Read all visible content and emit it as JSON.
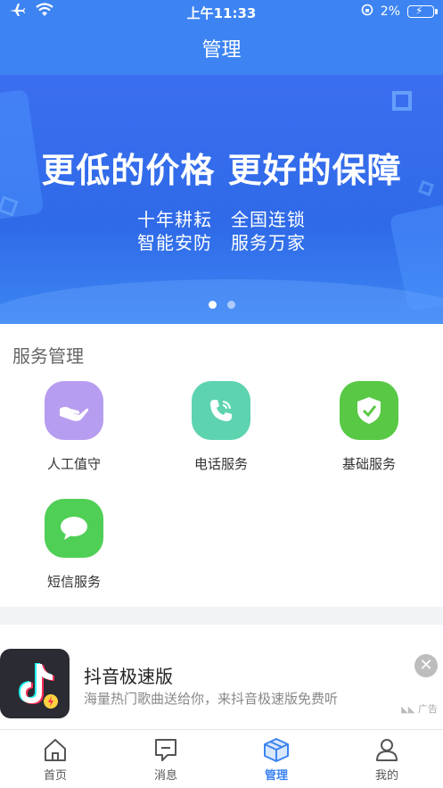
{
  "status_bar": {
    "time": "上午11:33",
    "battery": "2%",
    "icons": [
      "airplane-icon",
      "wifi-icon",
      "rotation-lock-icon",
      "battery-charging-icon"
    ]
  },
  "header": {
    "title": "管理"
  },
  "banner": {
    "headline": "更低的价格 更好的保障",
    "line1": "十年耕耘　全国连锁",
    "line2": "智能安防　服务万家",
    "page_indicator": {
      "count": 2,
      "active": 1
    }
  },
  "services": {
    "title": "服务管理",
    "items": [
      {
        "label": "人工值守",
        "icon": "hand-icon",
        "color": "#b79df0"
      },
      {
        "label": "电话服务",
        "icon": "phone-icon",
        "color": "#5ed3b0"
      },
      {
        "label": "基础服务",
        "icon": "shield-check-icon",
        "color": "#58c845"
      },
      {
        "label": "短信服务",
        "icon": "message-bubble-icon",
        "color": "#4fcf55"
      }
    ]
  },
  "ad": {
    "app_name": "抖音极速版",
    "description": "海量热门歌曲送给你，来抖音极速版免费听",
    "tag": "广告",
    "icon": "tiktok-icon"
  },
  "tabbar": {
    "items": [
      {
        "label": "首页",
        "icon": "home-icon"
      },
      {
        "label": "消息",
        "icon": "message-icon"
      },
      {
        "label": "管理",
        "icon": "box-icon",
        "active": true
      },
      {
        "label": "我的",
        "icon": "user-icon"
      }
    ]
  },
  "colors": {
    "primary": "#3d84f2"
  }
}
